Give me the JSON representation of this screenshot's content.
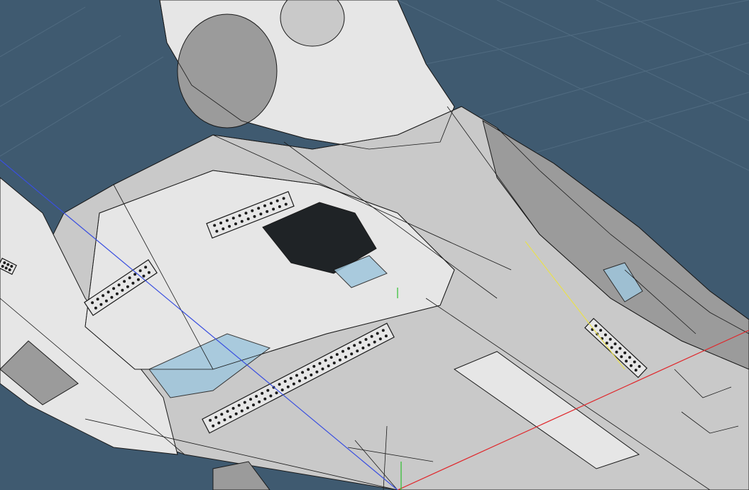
{
  "viewport": {
    "background_color": "#3f5a70",
    "grid_color": "#5f7a8f",
    "model": {
      "surface_color": "#c9c9c9",
      "surface_light": "#e6e6e6",
      "surface_dark": "#9b9b9b",
      "wire_color": "#1a1a1a",
      "cavity_color": "#1f2326",
      "glass_color": "#9fc6dc"
    },
    "axes": {
      "x_color": "#e0262a",
      "y_color": "#2fbf2f",
      "z_color": "#3a4fe0",
      "selection_color": "#e8e050"
    },
    "vent_count": 5
  }
}
